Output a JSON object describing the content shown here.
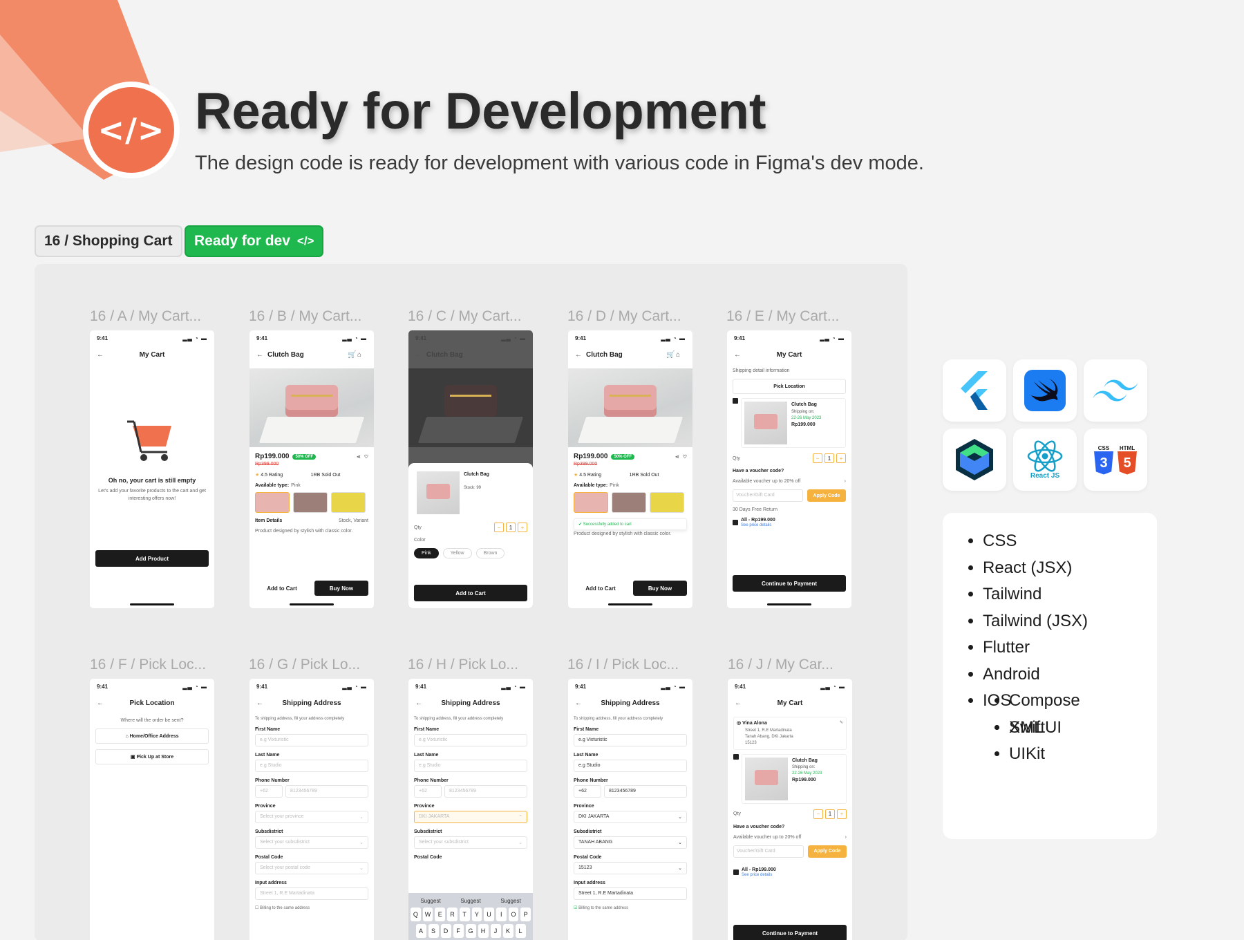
{
  "hero": {
    "logo_glyph": "</>",
    "title": "Ready for Development",
    "subtitle": "The design code is ready for development with various code in Figma's dev mode."
  },
  "tags": {
    "section": "16 / Shopping Cart",
    "status": "Ready for dev",
    "status_icon": "</>",
    "status_color": "#1fb84f",
    "accent": "#f0714d"
  },
  "frames": [
    {
      "label": "16 / A / My Cart..."
    },
    {
      "label": "16 / B / My Cart..."
    },
    {
      "label": "16 / C / My Cart..."
    },
    {
      "label": "16 / D / My Cart..."
    },
    {
      "label": "16 / E / My Cart..."
    },
    {
      "label": "16 / F / Pick Loc..."
    },
    {
      "label": "16 / G / Pick Lo..."
    },
    {
      "label": "16 / H / Pick Lo..."
    },
    {
      "label": "16 / I /  Pick Loc..."
    },
    {
      "label": "16 / J /  My Car..."
    }
  ],
  "common": {
    "time": "9:41",
    "my_cart": "My Cart",
    "clutch_bag": "Clutch Bag",
    "price": "Rp199.000",
    "old_price": "Rp399.000",
    "discount": "50% OFF",
    "rating": "4.5 Rating",
    "sold": "1RB Sold Out",
    "available_type": "Available type:",
    "available_value": "Pink",
    "item_details": "Item Details",
    "item_details_value": "Stock, Variant",
    "description": "Product designed by stylish with classic color.",
    "add_to_cart": "Add to Cart",
    "buy_now": "Buy Now",
    "pick_location": "Pick Location",
    "shipping_address": "Shipping Address",
    "continue": "Continue to Payment",
    "qty": "Qty",
    "qty_value": "1",
    "minus": "−",
    "plus": "+",
    "voucher_q": "Have a voucher code?",
    "voucher_avail": "Available voucher up to 20% off",
    "voucher_ph": "Voucher/Gift Card",
    "apply": "Apply Code",
    "all": "All - Rp199.000",
    "see_price": "See price details",
    "shipping_on": "Shipping on:",
    "shipping_date": "22-26 May 2023"
  },
  "frame_a": {
    "empty_title": "Oh no, your cart is still empty",
    "empty_desc": "Let's add your favorite products to the cart and get interesting offers now!",
    "button": "Add Product"
  },
  "frame_c": {
    "stock": "Stock: 99",
    "color_label": "Color",
    "colors": [
      "Pink",
      "Yellow",
      "Brown"
    ]
  },
  "frame_d": {
    "toast": "Successfully added to cart"
  },
  "frame_e": {
    "shipping_info": "Shipping detail information",
    "return": "30 Days Free Return"
  },
  "frame_f": {
    "question": "Where will the order be sent?",
    "home": "Home/Office Address",
    "pickup": "Pick Up at Store"
  },
  "form": {
    "intro": "To shipping address, fill your address completely",
    "first_name": "First Name",
    "first_ph": "e.g Vixturistic",
    "last_name": "Last Name",
    "last_ph": "e.g Studio",
    "phone": "Phone Number",
    "phone_code": "+62",
    "phone_ph": "8123456789",
    "province": "Province",
    "province_ph": "Select your province",
    "province_val": "DKI JAKARTA",
    "subdistrict": "Subsdistrict",
    "sub_ph": "Select your subsdistrict",
    "sub_val": "TANAH ABANG",
    "postal": "Postal Code",
    "postal_ph": "Select your postal code",
    "postal_val": "15123",
    "input_address": "Input address",
    "address_ph": "Street 1, R.E Martadinata",
    "address_val": "Street 1, R.E Martadinata",
    "billing": "Billing to the same address",
    "first_val": "e.g Vixturistic",
    "last_val": "e.g Studio"
  },
  "keyboard": {
    "suggest": "Suggest",
    "row1": [
      "Q",
      "W",
      "E",
      "R",
      "T",
      "Y",
      "U",
      "I",
      "O",
      "P"
    ],
    "row2": [
      "A",
      "S",
      "D",
      "F",
      "G",
      "H",
      "J",
      "K",
      "L"
    ]
  },
  "frame_j": {
    "name": "Vina Alona",
    "addr1": "Street 1, R.E Martadinata",
    "addr2": "Tanah Abang, DKI Jakarta",
    "zip": "15123"
  },
  "tech_icons": [
    "flutter-icon",
    "swift-icon",
    "tailwind-icon",
    "jetpack-compose-icon",
    "react-icon",
    "css-html-icon"
  ],
  "react_label": "React JS",
  "css_label": "CSS",
  "html_label": "HTML",
  "tech_list": {
    "css": "CSS",
    "react": "React (JSX)",
    "tailwind": "Tailwind",
    "tailwind_jsx": "Tailwind (JSX)",
    "flutter": "Flutter",
    "android": "Android",
    "compose": "Compose",
    "xml": "XML",
    "ios": "IOS",
    "swiftui": "SwiftUI",
    "uikit": "UIKit"
  }
}
